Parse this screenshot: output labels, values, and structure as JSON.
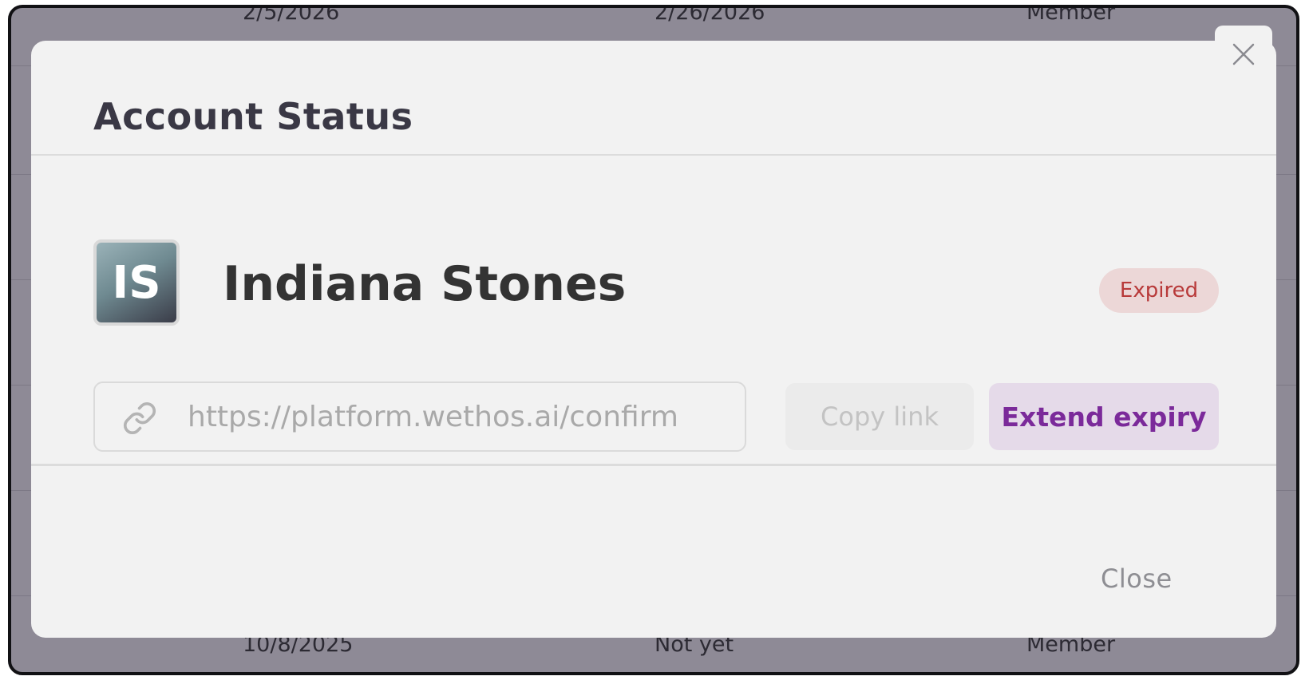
{
  "background_table": {
    "rows": [
      {
        "col1": "2/5/2026",
        "col2": "2/26/2026",
        "col3": "Member"
      },
      {
        "col1": "10/8/2025",
        "col2": "Not yet",
        "col3": "Member"
      }
    ]
  },
  "modal": {
    "title": "Account Status",
    "user": {
      "initials": "IS",
      "name": "Indiana Stones",
      "status": "Expired"
    },
    "link": {
      "value": "https://platform.wethos.ai/confirm",
      "icon": "link-icon"
    },
    "buttons": {
      "copy_link": "Copy link",
      "extend_expiry": "Extend expiry",
      "close": "Close"
    },
    "close_icon": "close-icon"
  },
  "colors": {
    "overlay": "#8e8a96",
    "modal_bg": "#f2f2f2",
    "status_badge_bg": "#ecd7d7",
    "status_badge_text": "#b83a3a",
    "primary_button_bg": "#e5dae9",
    "primary_button_text": "#7b2a9a"
  }
}
